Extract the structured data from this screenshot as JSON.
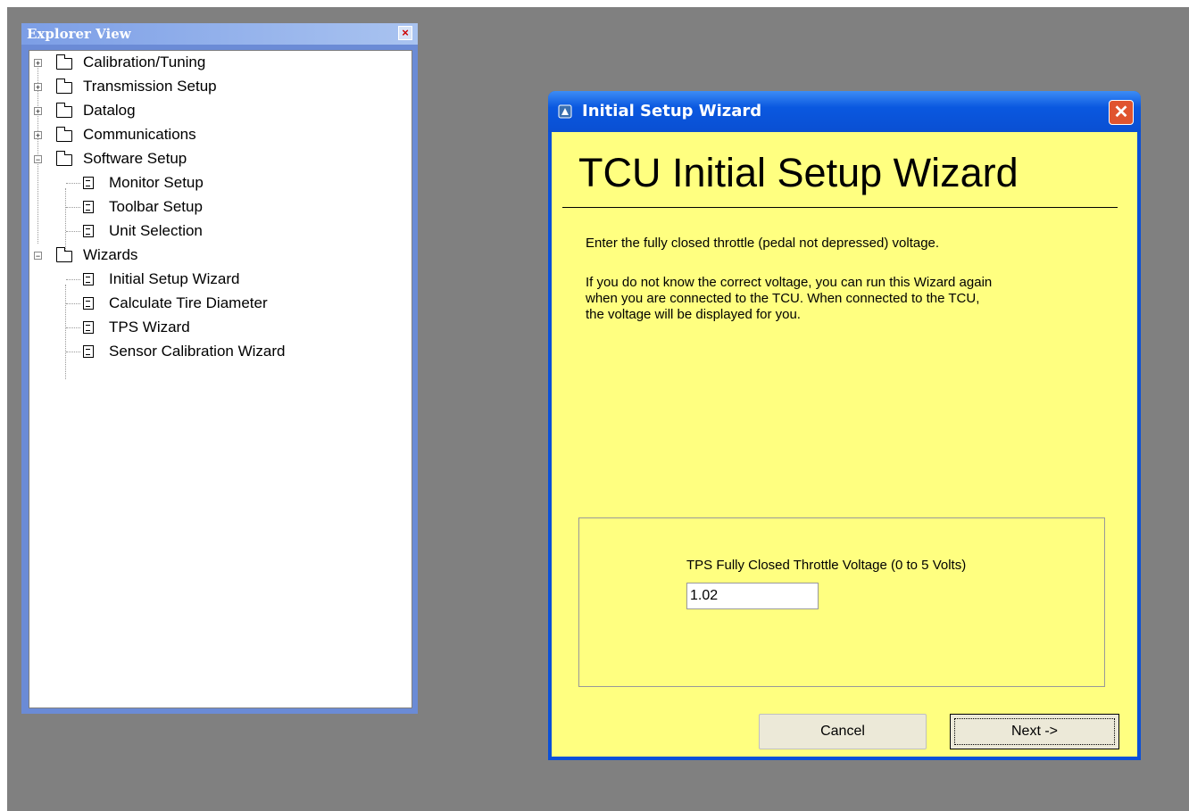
{
  "explorer": {
    "title": "Explorer View",
    "close_icon": "close-icon",
    "items": [
      {
        "label": "Calibration/Tuning",
        "type": "folder",
        "expanded": false,
        "level": 0
      },
      {
        "label": "Transmission Setup",
        "type": "folder",
        "expanded": false,
        "level": 0
      },
      {
        "label": "Datalog",
        "type": "folder",
        "expanded": false,
        "level": 0
      },
      {
        "label": "Communications",
        "type": "folder",
        "expanded": false,
        "level": 0
      },
      {
        "label": "Software Setup",
        "type": "folder",
        "expanded": true,
        "level": 0
      },
      {
        "label": "Monitor Setup",
        "type": "document",
        "level": 1
      },
      {
        "label": "Toolbar Setup",
        "type": "document",
        "level": 1
      },
      {
        "label": "Unit Selection",
        "type": "document",
        "level": 1
      },
      {
        "label": "Wizards",
        "type": "folder",
        "expanded": true,
        "level": 0
      },
      {
        "label": "Initial Setup Wizard",
        "type": "document",
        "level": 1
      },
      {
        "label": "Calculate Tire Diameter",
        "type": "document",
        "level": 1
      },
      {
        "label": "TPS Wizard",
        "type": "document",
        "level": 1
      },
      {
        "label": "Sensor Calibration Wizard",
        "type": "document",
        "level": 1
      }
    ]
  },
  "wizard": {
    "window_title": "Initial Setup Wizard",
    "heading": "TCU Initial Setup Wizard",
    "instruction": "Enter the fully closed throttle (pedal not depressed) voltage.",
    "note": "If you do not know the correct voltage, you can run this Wizard again\nwhen you are connected to the TCU. When connected to the TCU,\nthe voltage will be displayed for you.",
    "field_label": "TPS Fully Closed Throttle Voltage (0 to 5 Volts)",
    "field_value": "1.02",
    "cancel_label": "Cancel",
    "next_label": "Next ->"
  },
  "colors": {
    "desktop": "#808080",
    "dialog_body": "#ffff80",
    "titlebar": "#0a50d8",
    "close_button": "#e0542f"
  }
}
